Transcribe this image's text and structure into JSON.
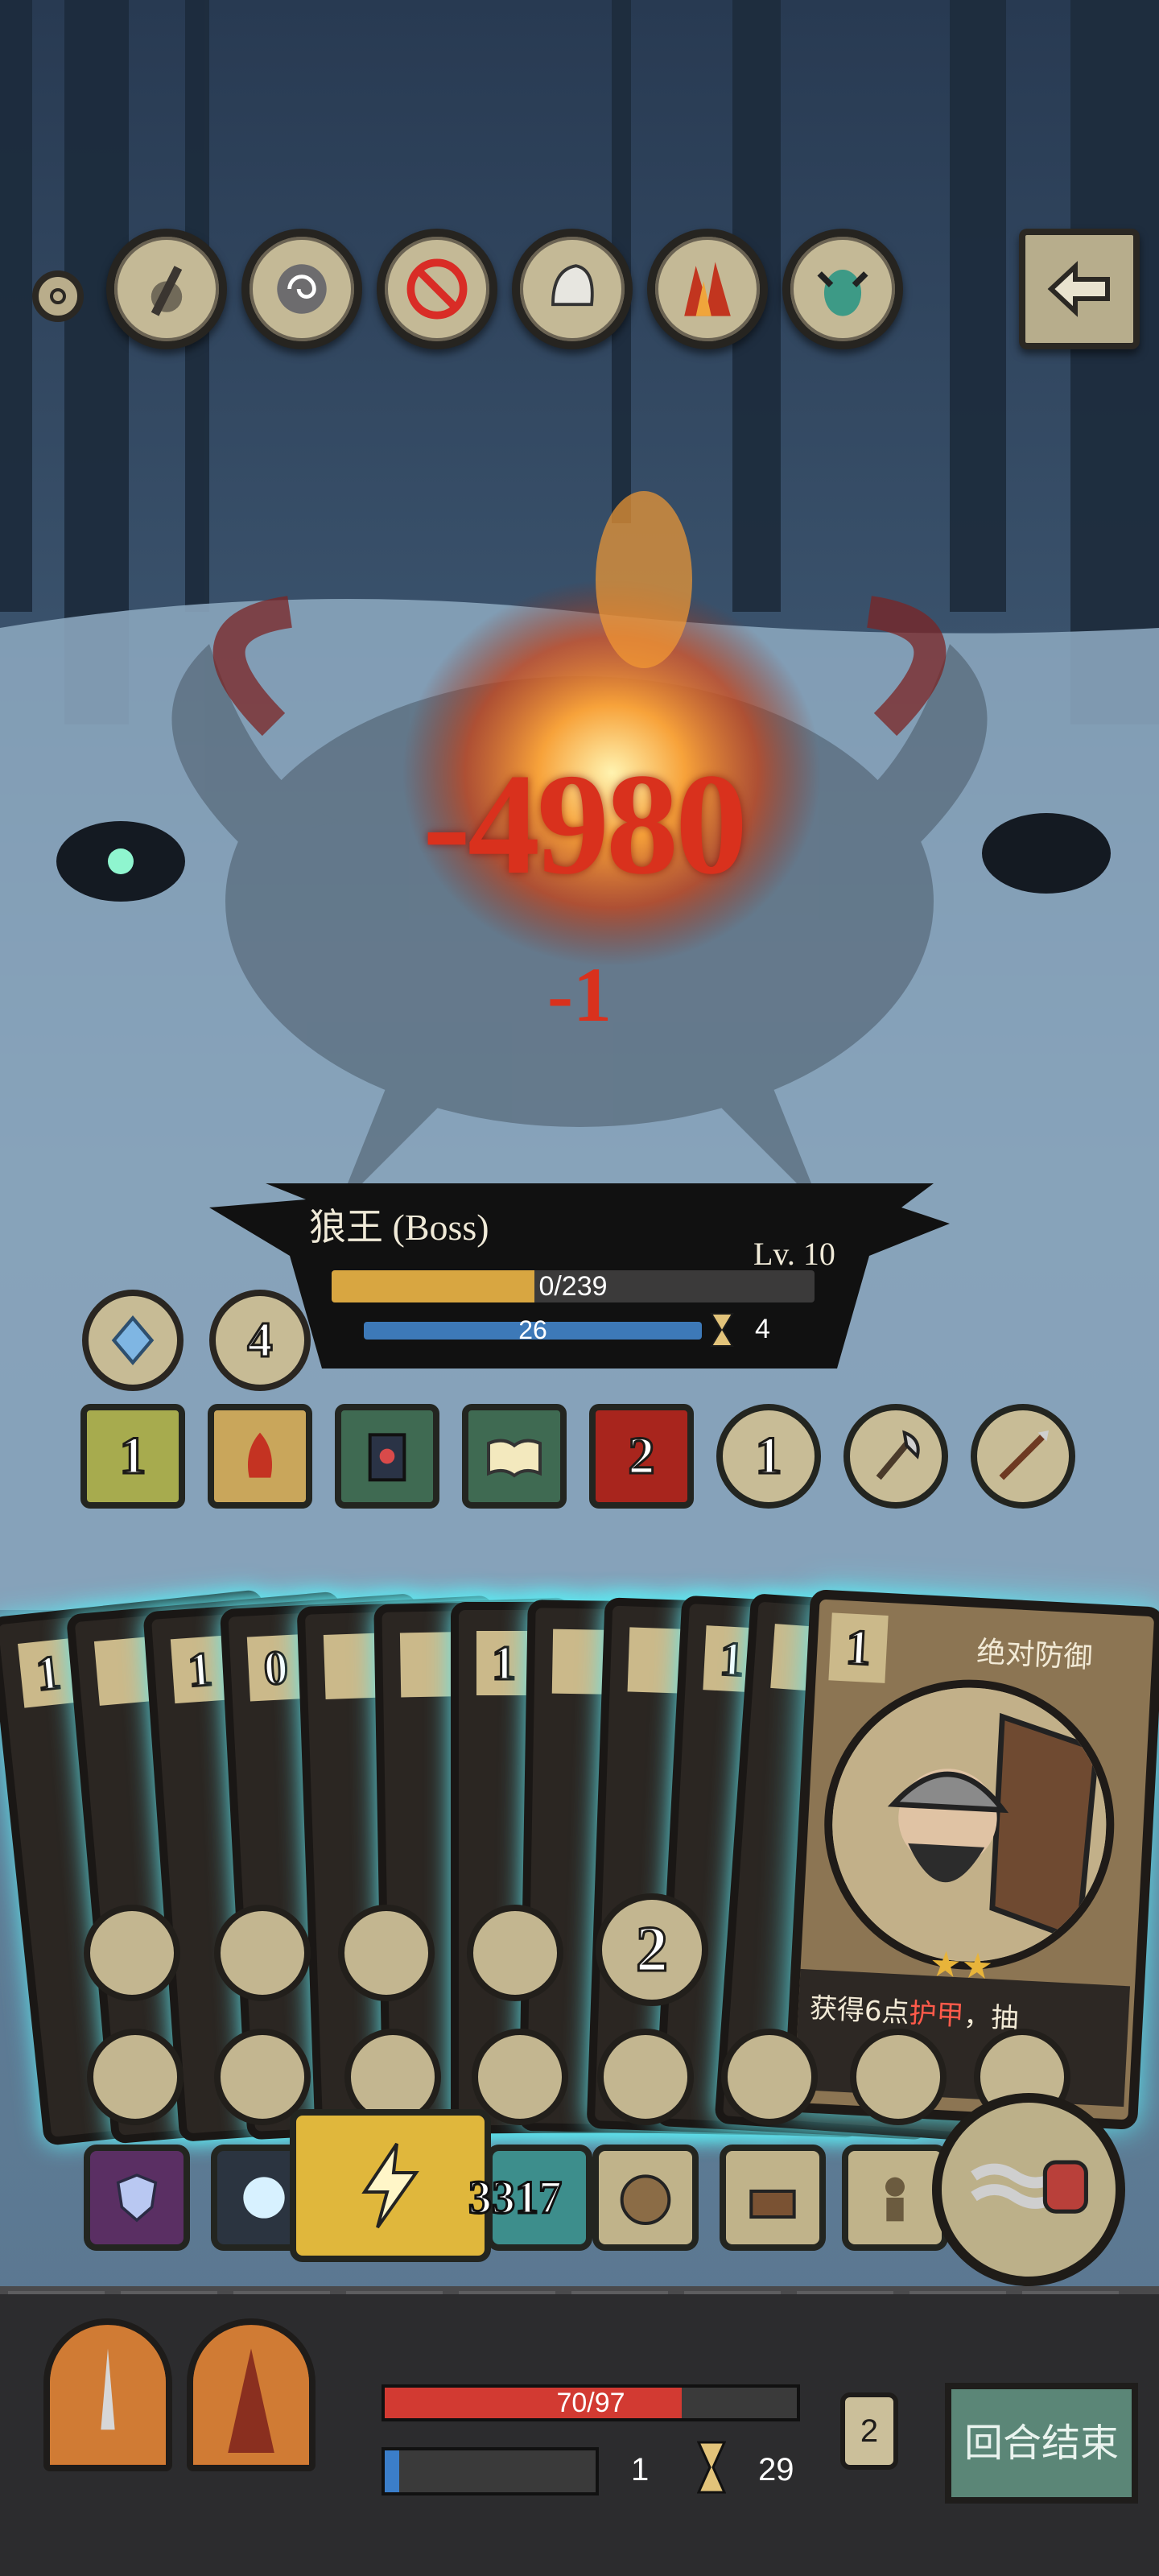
{
  "relics": [
    {
      "icon": "small-ring-icon"
    },
    {
      "icon": "broken-sword-relic-icon"
    },
    {
      "icon": "spiral-stone-relic-icon"
    },
    {
      "icon": "forbidden-sign-relic-icon"
    },
    {
      "icon": "helmet-relic-icon"
    },
    {
      "icon": "flame-relic-icon"
    },
    {
      "icon": "demon-totem-relic-icon"
    }
  ],
  "exit_icon": "back-arrow-icon",
  "damage": {
    "main": "-4980",
    "secondary": "-1"
  },
  "boss": {
    "name": "狼王 (Boss)",
    "level": "Lv. 10",
    "hp_text": "0/239",
    "hp_fraction": 0.42,
    "shield": "26",
    "turns": "4",
    "buffs": [
      {
        "icon": "frost-crystal-icon",
        "count": ""
      },
      {
        "icon": "poison-thorn-icon",
        "count": "4"
      }
    ],
    "intents": [
      {
        "icon": "claw-slash-icon",
        "count": "1"
      },
      {
        "icon": "fire-demon-icon",
        "count": ""
      },
      {
        "icon": "spellbook-icon",
        "count": ""
      },
      {
        "icon": "open-book-icon",
        "count": ""
      },
      {
        "icon": "blood-rage-icon",
        "count": "2"
      },
      {
        "icon": "sword-icon",
        "count": "1"
      },
      {
        "icon": "axe-icon",
        "count": ""
      },
      {
        "icon": "spear-icon",
        "count": ""
      }
    ]
  },
  "hand": {
    "back_cards": [
      {
        "cost": "1"
      },
      {
        "cost": ""
      },
      {
        "cost": "1"
      },
      {
        "cost": "0"
      },
      {
        "cost": ""
      },
      {
        "cost": ""
      },
      {
        "cost": "1"
      },
      {
        "cost": ""
      },
      {
        "cost": ""
      },
      {
        "cost": "1"
      },
      {
        "cost": ""
      }
    ],
    "featured": {
      "cost": "1",
      "title": "绝对防御",
      "stars": "★★",
      "desc_prefix": "获得6点",
      "desc_highlight": "护甲",
      "desc_suffix": "，抽"
    },
    "card_icons": [
      {
        "icon": "wooden-door-icon",
        "num": ""
      },
      {
        "icon": "green-skull-icon",
        "num": ""
      },
      {
        "icon": "wooden-horse-icon",
        "num": ""
      },
      {
        "icon": "skull-coin-icon",
        "num": ""
      },
      {
        "icon": "dagger-icon",
        "num": "2"
      },
      {
        "icon": "skull-bones-icon",
        "num": ""
      },
      {
        "icon": "wooden-door-icon",
        "num": ""
      },
      {
        "icon": "purple-flower-icon",
        "num": ""
      },
      {
        "icon": "spear-thrust-icon",
        "num": ""
      },
      {
        "icon": "skull-bones-icon",
        "num": ""
      },
      {
        "icon": "knight-icon",
        "num": ""
      },
      {
        "icon": "green-skull-icon",
        "num": ""
      },
      {
        "icon": "spear-thrust-icon",
        "num": ""
      }
    ]
  },
  "tray": {
    "count": "3317",
    "items": [
      {
        "icon": "purple-shield-icon"
      },
      {
        "icon": "blue-orb-icon"
      },
      {
        "icon": "lightning-icon"
      },
      {
        "icon": "teal-rune-icon"
      },
      {
        "icon": "arena-icon"
      },
      {
        "icon": "treasure-cart-icon"
      },
      {
        "icon": "traveler-icon"
      }
    ],
    "skill_icon": "spring-fist-icon"
  },
  "player": {
    "hp_text": "70/97",
    "hp_fraction": 0.72,
    "mana_fraction": 0.07,
    "energy": "1",
    "turns": "29",
    "deck_count": "2",
    "end_turn": "回合结束",
    "portraits": [
      {
        "icon": "warrior-portrait-icon"
      },
      {
        "icon": "hooded-mage-portrait-icon"
      }
    ]
  },
  "colors": {
    "damage": "#d9311d",
    "boss_hp": "#d8a641",
    "shield": "#3d79b8",
    "player_hp": "#d23a32",
    "mana": "#3b7ec9",
    "card_glow": "#5de6f0",
    "end_turn_bg": "#5b8677"
  }
}
